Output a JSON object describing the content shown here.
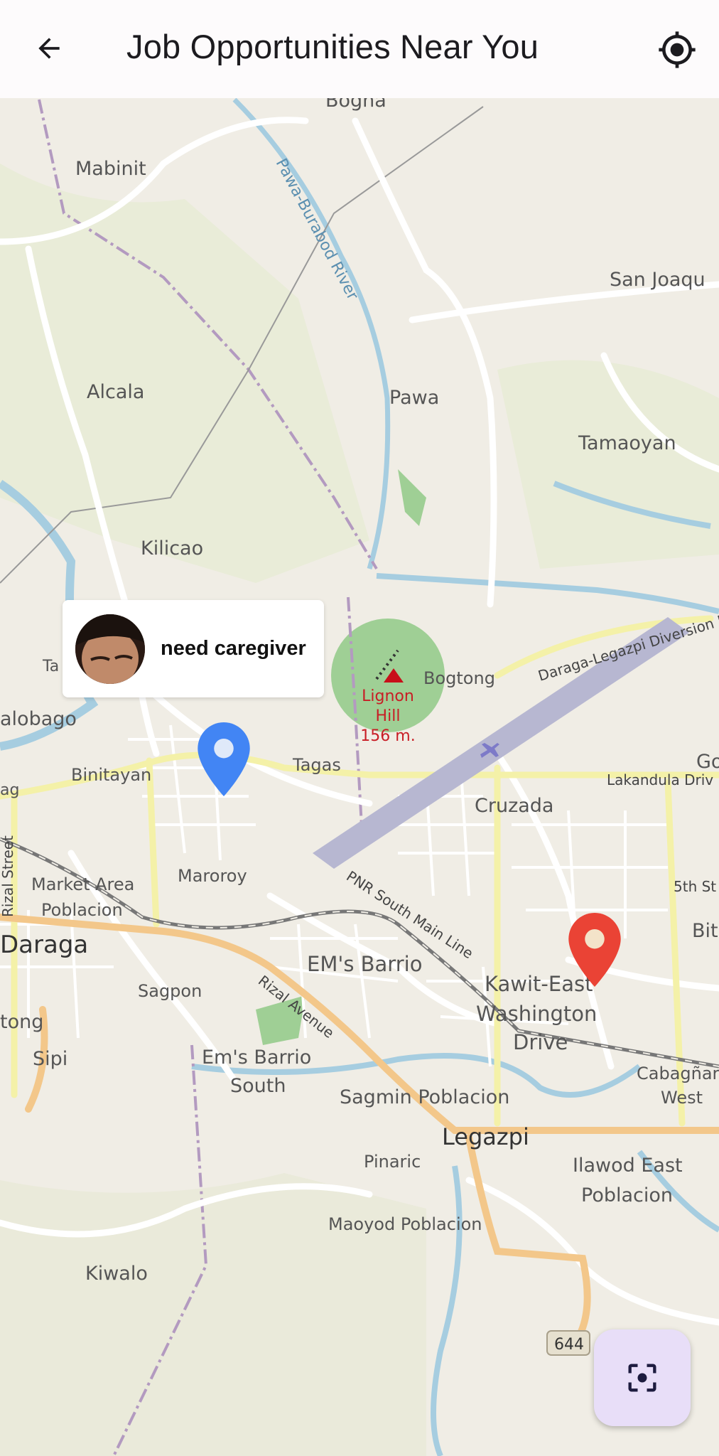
{
  "appbar": {
    "title": "Job Opportunities Near You",
    "back_icon": "arrow-left-icon",
    "locate_icon": "my-location-icon"
  },
  "map": {
    "places": {
      "bogna": "Bogna",
      "mabinit": "Mabinit",
      "river_pawa": "Pawa-Burabod River",
      "san_joaquin": "San Joaqu",
      "alcala": "Alcala",
      "pawa": "Pawa",
      "tamaoyan": "Tamaoyan",
      "kilicao": "Kilicao",
      "ta": "Ta",
      "alobago": "alobago",
      "lignon": "Lignon",
      "hill": "Hill",
      "elev": "156 m.",
      "bogtong": "Bogtong",
      "diversion": "Daraga-Legazpi Diversion R",
      "binitayan": "Binitayan",
      "tagas": "Tagas",
      "gog": "Gog",
      "lakandula": "Lakandula Driv",
      "ag": "ag",
      "cruzada": "Cruzada",
      "rizal_street": "Rizal Street",
      "market_area": "Market Area",
      "poblacion": "Poblacion",
      "maroroy": "Maroroy",
      "pnr": "PNR South Main Line",
      "fifth_st": "5th St",
      "bit": "Bit",
      "daraga": "Daraga",
      "ems_barrio": "EM's Barrio",
      "kawit_east": "Kawit-East",
      "washington": "Washington",
      "drive": "Drive",
      "sagpon": "Sagpon",
      "rizal_avenue": "Rizal Avenue",
      "tong": "tong",
      "sipi": "Sipi",
      "ems_barrio_south_1": "Em's Barrio",
      "ems_barrio_south_2": "South",
      "cabagnan": "Cabagñar",
      "west": "West",
      "sagmin": "Sagmin Poblacion",
      "legazpi": "Legazpi",
      "pinaric": "Pinaric",
      "ilawod_1": "Ilawod East",
      "ilawod_2": "Poblacion",
      "maoyod": "Maoyod Poblacion",
      "kiwalo": "Kiwalo",
      "route": "644"
    }
  },
  "job_marker": {
    "label": "need caregiver",
    "avatar": "user-avatar",
    "pin_color": "#4285f4"
  },
  "user_marker": {
    "pin_color": "#ea4335"
  },
  "fab": {
    "icon": "center-focus-icon",
    "background": "#e8def8"
  }
}
